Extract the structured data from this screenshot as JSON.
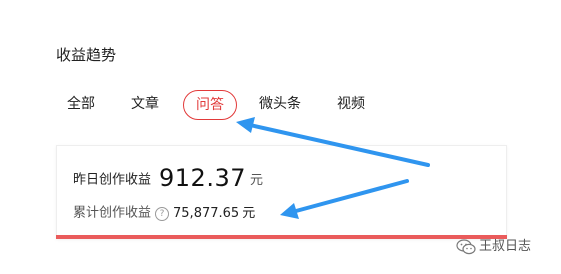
{
  "section": {
    "title": "收益趋势"
  },
  "tabs": [
    {
      "label": "全部",
      "active": false
    },
    {
      "label": "文章",
      "active": false
    },
    {
      "label": "问答",
      "active": true
    },
    {
      "label": "微头条",
      "active": false
    },
    {
      "label": "视频",
      "active": false
    }
  ],
  "card": {
    "yesterday_label": "昨日创作收益",
    "yesterday_value": "912.37",
    "yesterday_unit": "元",
    "total_label": "累计创作收益",
    "help_icon_glyph": "?",
    "total_value": "75,877.65",
    "total_unit": "元"
  },
  "watermark": {
    "text": "王叔日志",
    "icon": "wechat-icon"
  },
  "colors": {
    "accent": "#e23a3a",
    "card_bar": "#ea5b5b",
    "arrow": "#2f95ef"
  }
}
